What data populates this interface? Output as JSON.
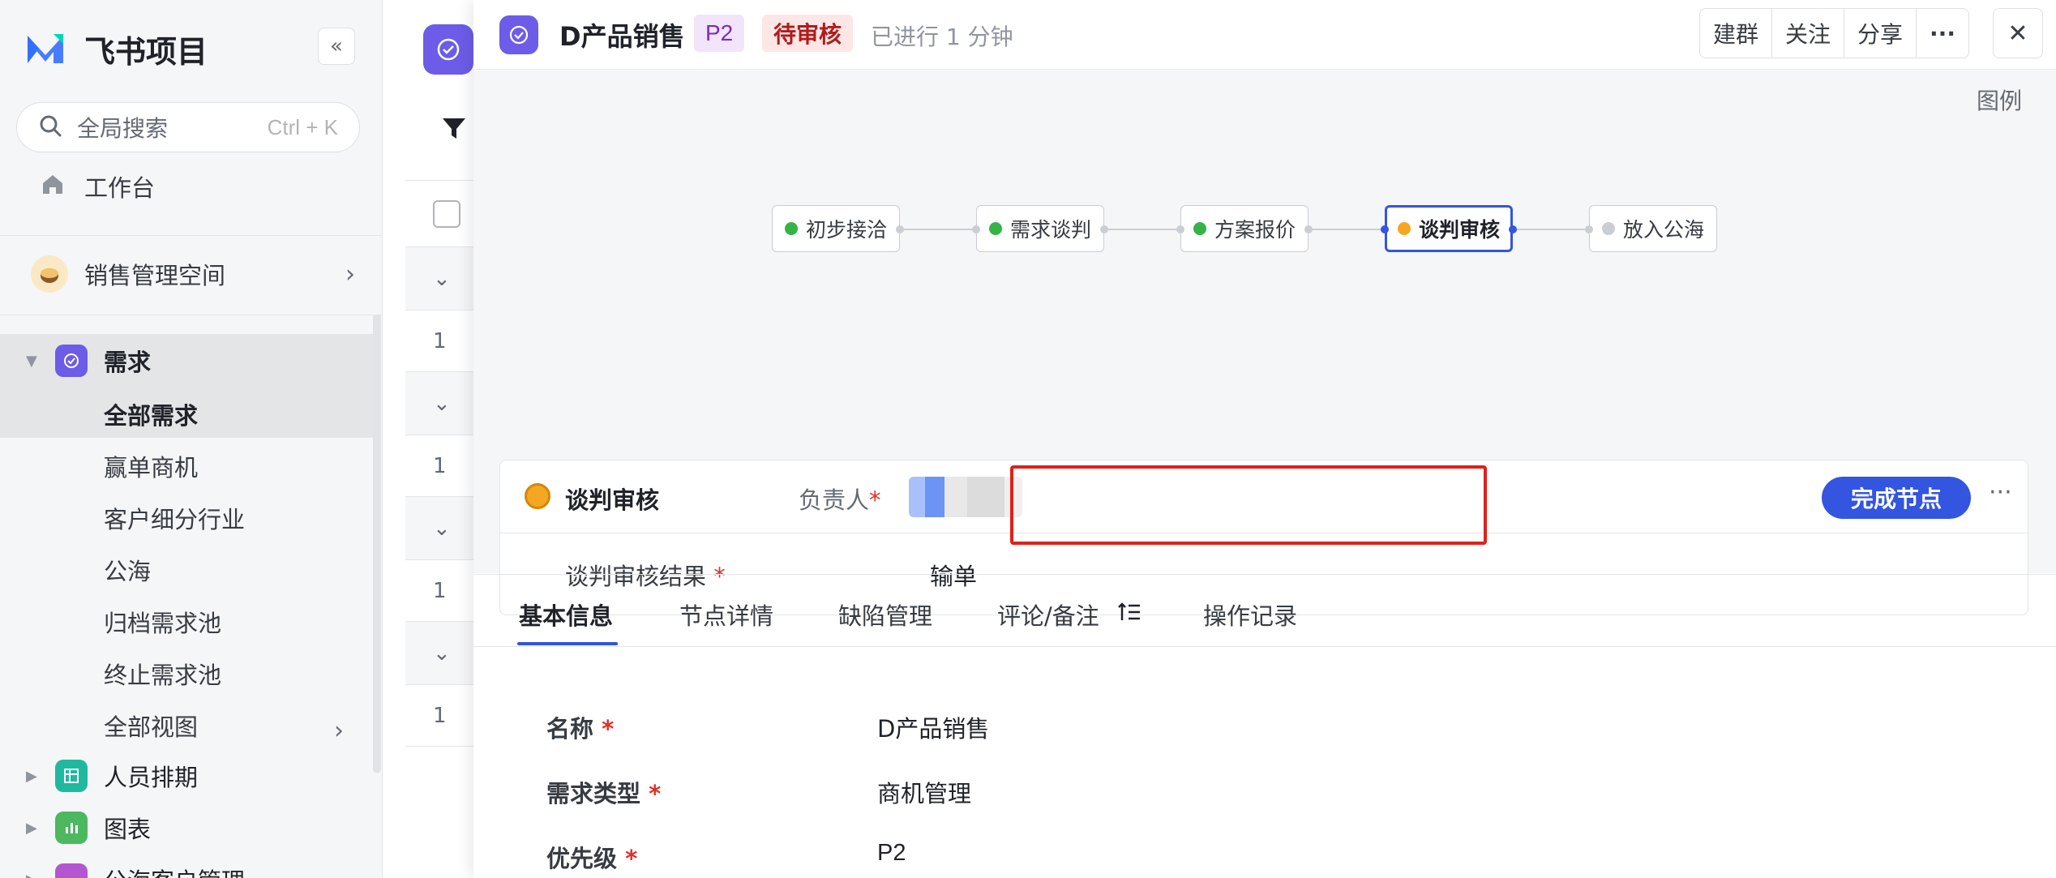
{
  "app": {
    "name": "飞书项目",
    "collapse_glyph": "«"
  },
  "search": {
    "placeholder": "全局搜索",
    "shortcut": "Ctrl + K"
  },
  "sidebar": {
    "workbench": "工作台",
    "space": "销售管理空间",
    "tree": {
      "requirements": {
        "label": "需求",
        "items": [
          "全部需求",
          "赢单商机",
          "客户细分行业",
          "公海",
          "归档需求池",
          "终止需求池",
          "全部视图"
        ]
      },
      "others": [
        {
          "label": "人员排期",
          "color": "#1fb9a0"
        },
        {
          "label": "图表",
          "color": "#4cb85f"
        },
        {
          "label": "公海客户管理",
          "color": "#b455d1"
        }
      ]
    }
  },
  "list": {
    "row_numbers": [
      "1",
      "1",
      "1",
      "1"
    ]
  },
  "panel": {
    "title": "D产品销售",
    "priority": "P2",
    "status": "待审核",
    "elapsed": "已进行 1 分钟",
    "actions": [
      "建群",
      "关注",
      "分享",
      "···"
    ],
    "close": "✕",
    "legend": "图例",
    "workflow": {
      "nodes": [
        {
          "label": "初步接洽",
          "state": "done",
          "color": "#34b346"
        },
        {
          "label": "需求谈判",
          "state": "done",
          "color": "#34b346"
        },
        {
          "label": "方案报价",
          "state": "done",
          "color": "#34b346"
        },
        {
          "label": "谈判审核",
          "state": "active",
          "color": "#f5a623"
        },
        {
          "label": "放入公海",
          "state": "pending",
          "color": "#c9cdd4"
        }
      ]
    },
    "node_card": {
      "title": "谈判审核",
      "owner_label": "负责人",
      "required_mark": "*",
      "complete_button": "完成节点",
      "more": "···",
      "result_label": "谈判审核结果",
      "result_value": "输单"
    },
    "tabs": [
      "基本信息",
      "节点详情",
      "缺陷管理",
      "评论/备注",
      "操作记录"
    ],
    "basic_info": [
      {
        "label": "名称",
        "value": "D产品销售"
      },
      {
        "label": "需求类型",
        "value": "商机管理"
      },
      {
        "label": "优先级",
        "value": "P2"
      }
    ]
  }
}
